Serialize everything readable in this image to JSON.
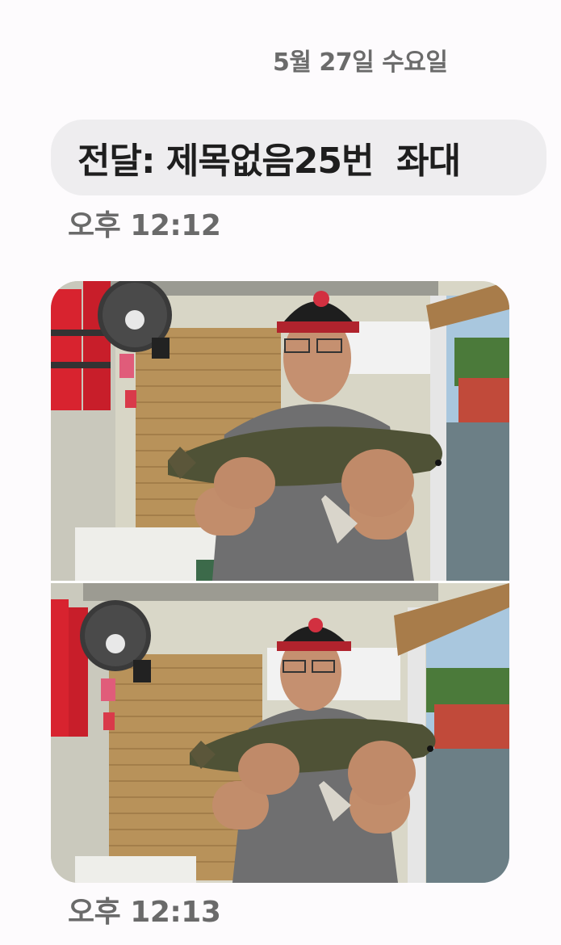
{
  "conversation": {
    "date_header": "5월 27일 수요일",
    "messages": [
      {
        "type": "text",
        "text": "전달: 제목없음25번  좌대",
        "time": "오후 12:12"
      },
      {
        "type": "media",
        "photos": [
          {
            "subject": "man-holding-fish-photo"
          },
          {
            "subject": "man-holding-fish-photo"
          }
        ],
        "time": "오후 12:13"
      }
    ]
  },
  "colors": {
    "background": "#fdfbfd",
    "bubble": "#eeedef",
    "text_primary": "#1e1e1e",
    "text_secondary": "#6a6a6a"
  }
}
